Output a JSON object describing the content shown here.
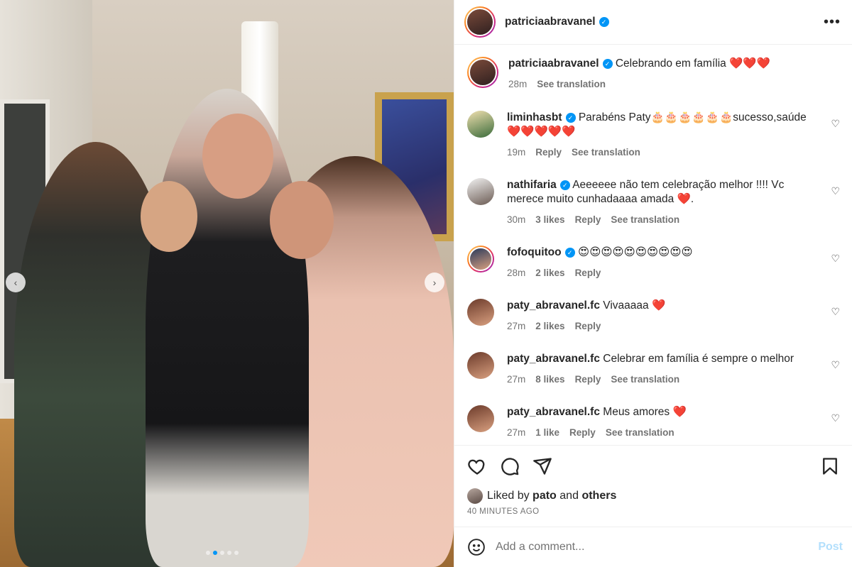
{
  "post": {
    "username": "patriciaabravanel",
    "caption": "Celebrando em família ❤️❤️❤️",
    "caption_time": "28m",
    "caption_translate": "See translation",
    "carousel": {
      "slides": 5,
      "active_index": 1
    }
  },
  "comments": [
    {
      "username": "liminhasbt",
      "verified": true,
      "text": "Parabéns Paty🎂🎂🎂🎂🎂🎂sucesso,saúde ❤️❤️❤️❤️❤️",
      "time": "19m",
      "likes": "",
      "reply": "Reply",
      "translate": "See translation"
    },
    {
      "username": "nathifaria",
      "verified": true,
      "text": "Aeeeeee não tem celebração melhor !!!! Vc merece muito cunhadaaaa amada ❤️.",
      "time": "30m",
      "likes": "3 likes",
      "reply": "Reply",
      "translate": "See translation"
    },
    {
      "username": "fofoquitoo",
      "verified": true,
      "text": "😍😍😍😍😍😍😍😍😍😍",
      "time": "28m",
      "likes": "2 likes",
      "reply": "Reply",
      "translate": ""
    },
    {
      "username": "paty_abravanel.fc",
      "verified": false,
      "text": "Vivaaaaa ❤️",
      "time": "27m",
      "likes": "2 likes",
      "reply": "Reply",
      "translate": ""
    },
    {
      "username": "paty_abravanel.fc",
      "verified": false,
      "text": "Celebrar em família é sempre o melhor",
      "time": "27m",
      "likes": "8 likes",
      "reply": "Reply",
      "translate": "See translation"
    },
    {
      "username": "paty_abravanel.fc",
      "verified": false,
      "text": "Meus amores ❤️",
      "time": "27m",
      "likes": "1 like",
      "reply": "Reply",
      "translate": "See translation"
    }
  ],
  "likes": {
    "prefix": "Liked by",
    "user": "pato",
    "joiner": "and",
    "others": "others",
    "time_ago": "40 MINUTES AGO"
  },
  "add_comment": {
    "placeholder": "Add a comment...",
    "post_label": "Post"
  },
  "icons": {
    "more": "more-options-icon",
    "like": "heart-icon",
    "comment": "comment-icon",
    "share": "share-icon",
    "save": "bookmark-icon",
    "emoji": "emoji-icon"
  },
  "colors": {
    "accent": "#0095f6",
    "post_disabled": "#b2dffc",
    "secondary_text": "#737373"
  }
}
